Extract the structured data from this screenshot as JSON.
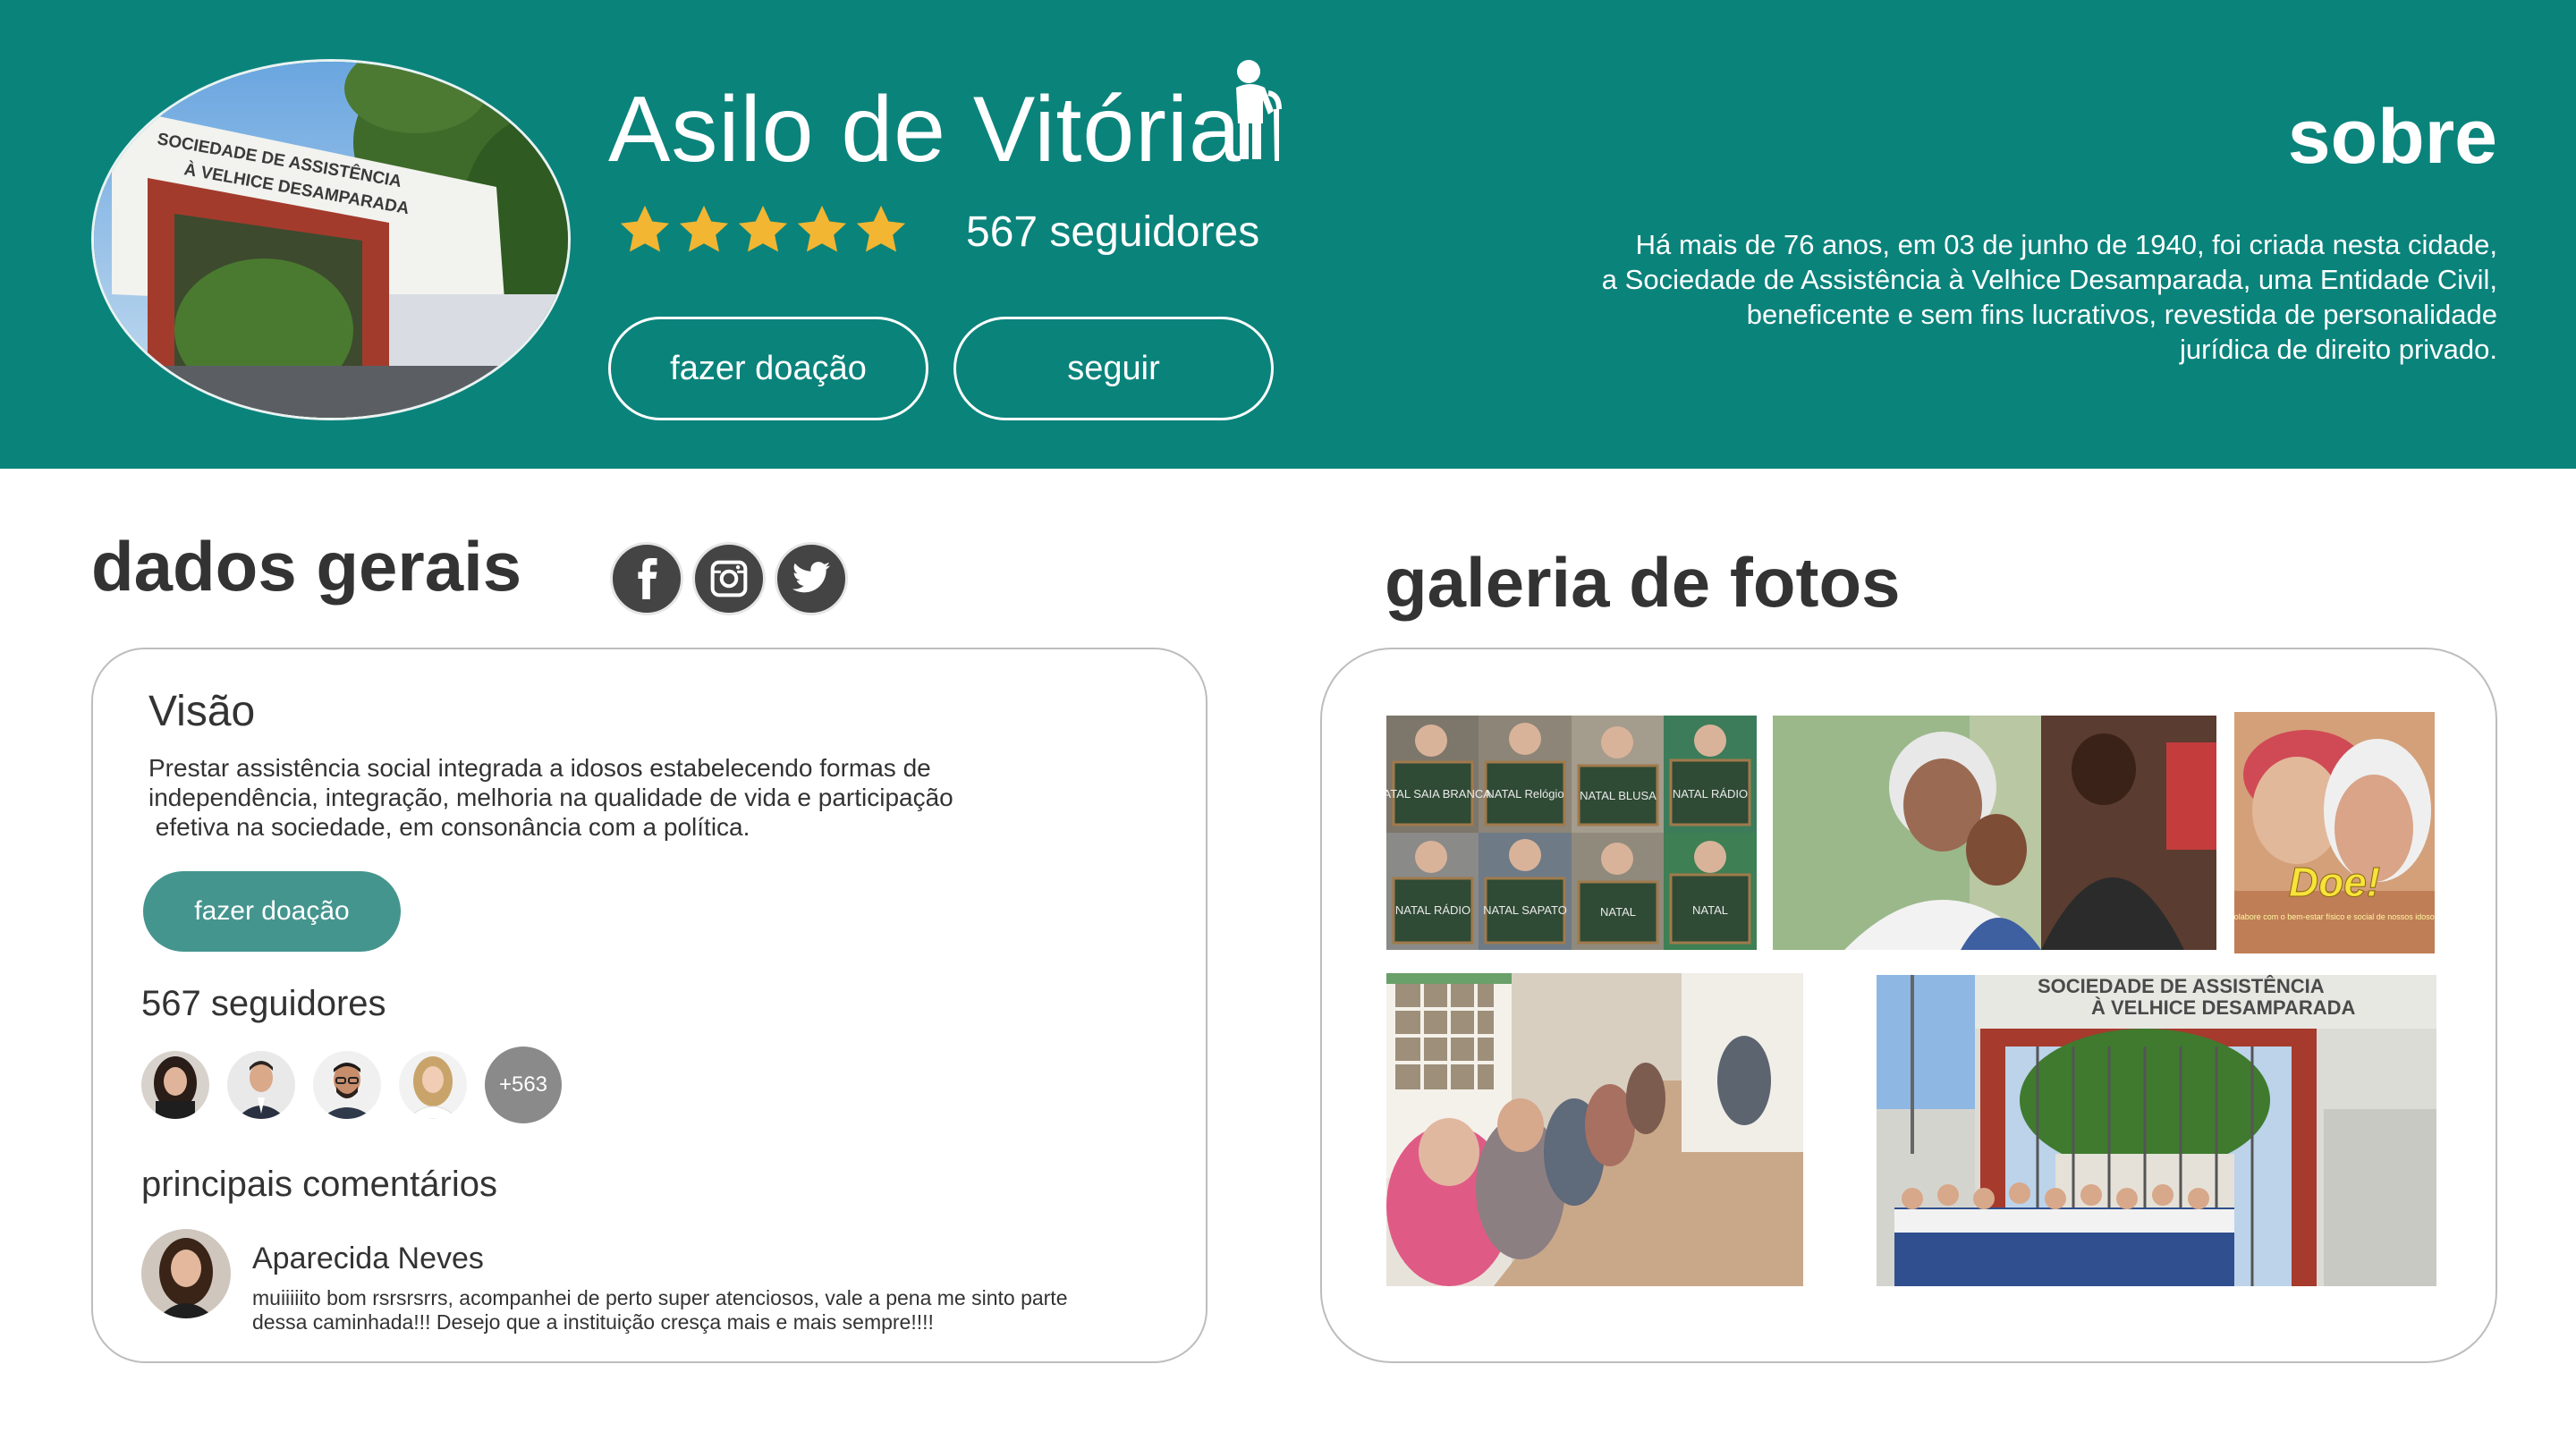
{
  "header": {
    "title": "Asilo de Vitória",
    "rating_stars": 5,
    "followers": "567 seguidores",
    "donate_label": "fazer doação",
    "follow_label": "seguir",
    "hero_photo_sign": [
      "SOCIEDADE DE ASSISTÊNCIA",
      "À VELHICE DESAMPARADA"
    ]
  },
  "sobre": {
    "title": "sobre",
    "text_lines": [
      "Há mais de 76 anos, em 03 de junho de 1940, foi criada nesta cidade,",
      "a Sociedade de Assistência à Velhice Desamparada, uma Entidade Civil,",
      "beneficente e sem fins lucrativos, revestida de personalidade",
      "jurídica de direito privado."
    ]
  },
  "dados": {
    "title": "dados gerais",
    "social_icons": [
      "facebook-icon",
      "instagram-icon",
      "twitter-icon"
    ],
    "visao_title": "Visão",
    "visao_lines": [
      "Prestar assistência social integrada a idosos estabelecendo formas de",
      "independência, integração, melhoria na qualidade de vida e participação",
      " efetiva na sociedade, em consonância com a política."
    ],
    "donate_label": "fazer doação",
    "followers": "567 seguidores",
    "more_followers": "+563",
    "comments_title": "principais comentários",
    "comment": {
      "author": "Aparecida Neves",
      "lines": [
        "muiiiiito bom rsrsrsrrs, acompanhei de perto super atenciosos, vale a pena me sinto parte",
        "dessa caminhada!!! Desejo que a instituição cresça mais e mais sempre!!!!"
      ]
    }
  },
  "galeria": {
    "title": "galeria de fotos",
    "chalkboards": [
      "NATAL SAIA BRANCA",
      "NATAL Relógio",
      "NATAL BLUSA",
      "NATAL RÁDIO",
      "NATAL RÁDIO",
      "NATAL SAPATO",
      "NATAL",
      "NATAL"
    ],
    "poster_title": "Doe!",
    "poster_caption": "Colabore com o bem-estar físico e social de nossos idosos.",
    "building_sign": [
      "SOCIEDADE DE ASSISTÊNCIA",
      "À VELHICE DESAMPARADA"
    ]
  },
  "colors": {
    "header_bg": "#0a837b",
    "accent_button": "#45958f",
    "star": "#f2b632",
    "text": "#333333"
  }
}
